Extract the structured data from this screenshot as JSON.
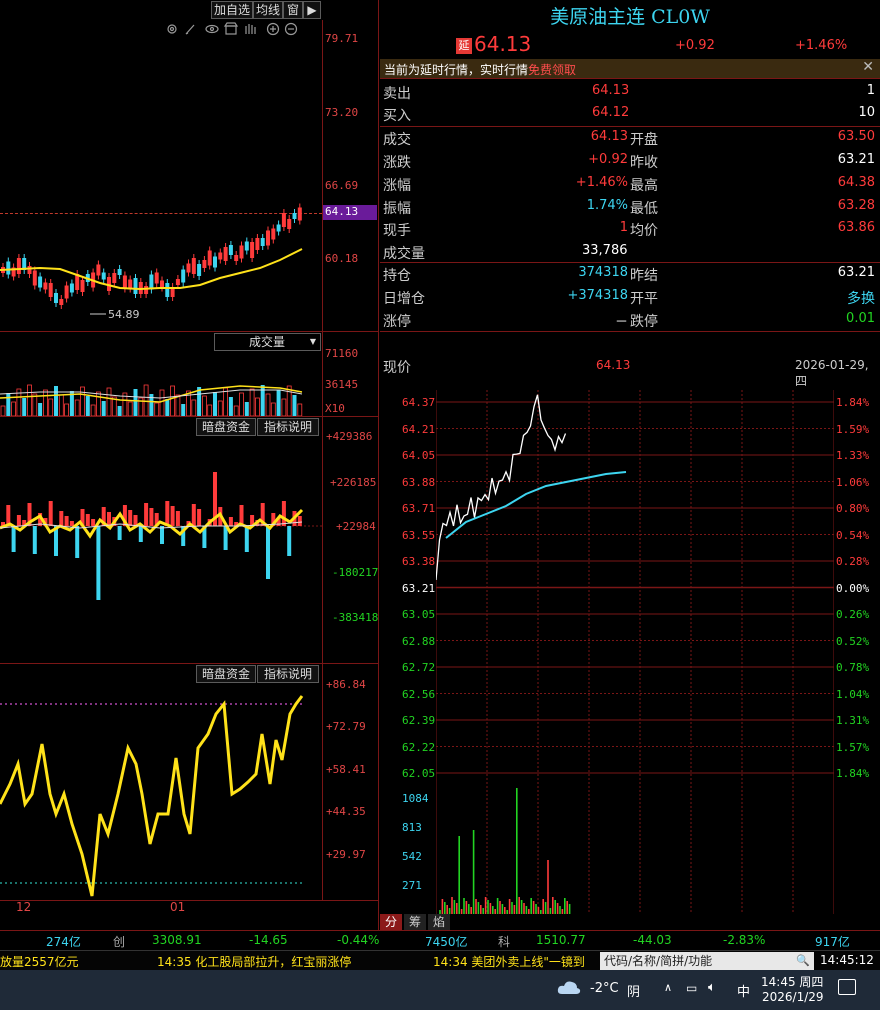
{
  "toolbar": {
    "add_watch": "加自选",
    "ma_line": "均线",
    "window": "窗"
  },
  "kline": {
    "y_labels": [
      "79.71",
      "73.20",
      "66.69",
      "60.18"
    ],
    "current": "64.13",
    "low_mark": "54.89",
    "x_labels": [
      "12",
      "01"
    ]
  },
  "volume_panel": {
    "dropdown": "成交量",
    "y_labels": [
      "71160",
      "36145"
    ],
    "unit": "X10"
  },
  "money_panel": {
    "tab1": "暗盘资金",
    "tab2": "指标说明",
    "y_labels": [
      "+429386",
      "+226185",
      "+22984",
      "-180217",
      "-383418"
    ]
  },
  "osc_panel": {
    "tab1": "暗盘资金",
    "tab2": "指标说明",
    "y_labels": [
      "+86.84",
      "+72.79",
      "+58.41",
      "+44.35",
      "+29.97"
    ]
  },
  "quote": {
    "title": "美原油主连 CL0W",
    "delay_tag": "延",
    "price": "64.13",
    "change": "+0.92",
    "change_pct": "+1.46%",
    "notice": "当前为延时行情，实时行情",
    "notice_link": "免费领取",
    "sell_label": "卖出",
    "sell_price": "64.13",
    "sell_vol": "1",
    "buy_label": "买入",
    "buy_price": "64.12",
    "buy_vol": "10",
    "rows": [
      {
        "l1": "成交",
        "v1": "64.13",
        "l2": "开盘",
        "v2": "63.50"
      },
      {
        "l1": "涨跌",
        "v1": "+0.92",
        "l2": "昨收",
        "v2": "63.21"
      },
      {
        "l1": "涨幅",
        "v1": "+1.46%",
        "l2": "最高",
        "v2": "64.38"
      },
      {
        "l1": "振幅",
        "v1": "1.74%",
        "l2": "最低",
        "v2": "63.28"
      },
      {
        "l1": "现手",
        "v1": "1",
        "l2": "均价",
        "v2": "63.86"
      }
    ],
    "volume_label": "成交量",
    "volume_value": "33,786",
    "oi_label": "持仓",
    "oi_value": "374318",
    "prev_settle_label": "昨结",
    "prev_settle": "63.21",
    "daily_oi_label": "日增仓",
    "daily_oi_value": "+374318",
    "open_close_label": "开平",
    "open_close_value": "多换",
    "limit_up_label": "涨停",
    "limit_up_value": "－",
    "limit_down_label": "跌停",
    "limit_down_value": "0.01"
  },
  "intraday": {
    "label": "现价",
    "price": "64.13",
    "date": "2026-01-29,四",
    "left_axis": [
      "64.37",
      "64.21",
      "64.05",
      "63.88",
      "63.71",
      "63.55",
      "63.38",
      "63.21",
      "63.05",
      "62.88",
      "62.72",
      "62.56",
      "62.39",
      "62.22",
      "62.05"
    ],
    "right_axis": [
      "1.84%",
      "1.59%",
      "1.33%",
      "1.06%",
      "0.80%",
      "0.54%",
      "0.28%",
      "0.00%",
      "0.26%",
      "0.52%",
      "0.78%",
      "1.04%",
      "1.31%",
      "1.57%",
      "1.84%"
    ],
    "vol_axis": [
      "1084",
      "813",
      "542",
      "271"
    ],
    "tabs": [
      "分",
      "筹",
      "焰"
    ]
  },
  "ticker": [
    {
      "v": "274亿",
      "c": "cyan"
    },
    {
      "v": "创",
      "c": "gray"
    },
    {
      "v": "3308.91",
      "c": "grn"
    },
    {
      "v": "-14.65",
      "c": "grn"
    },
    {
      "v": "-0.44%",
      "c": "grn"
    },
    {
      "v": "7450亿",
      "c": "cyan"
    },
    {
      "v": "科",
      "c": "gray"
    },
    {
      "v": "1510.77",
      "c": "grn"
    },
    {
      "v": "-44.03",
      "c": "grn"
    },
    {
      "v": "-2.83%",
      "c": "grn"
    },
    {
      "v": "917亿",
      "c": "cyan"
    }
  ],
  "news": [
    "放量2557亿元",
    "14:35 化工股局部拉升，红宝丽涨停",
    "14:34 美团外卖上线\"一镜到"
  ],
  "search_placeholder": "代码/名称/简拼/功能",
  "clock": "14:45:12",
  "taskbar": {
    "temp": "-2°C",
    "weather": "阴",
    "ime": "中",
    "time": "14:45 周四",
    "date": "2026/1/29"
  }
}
